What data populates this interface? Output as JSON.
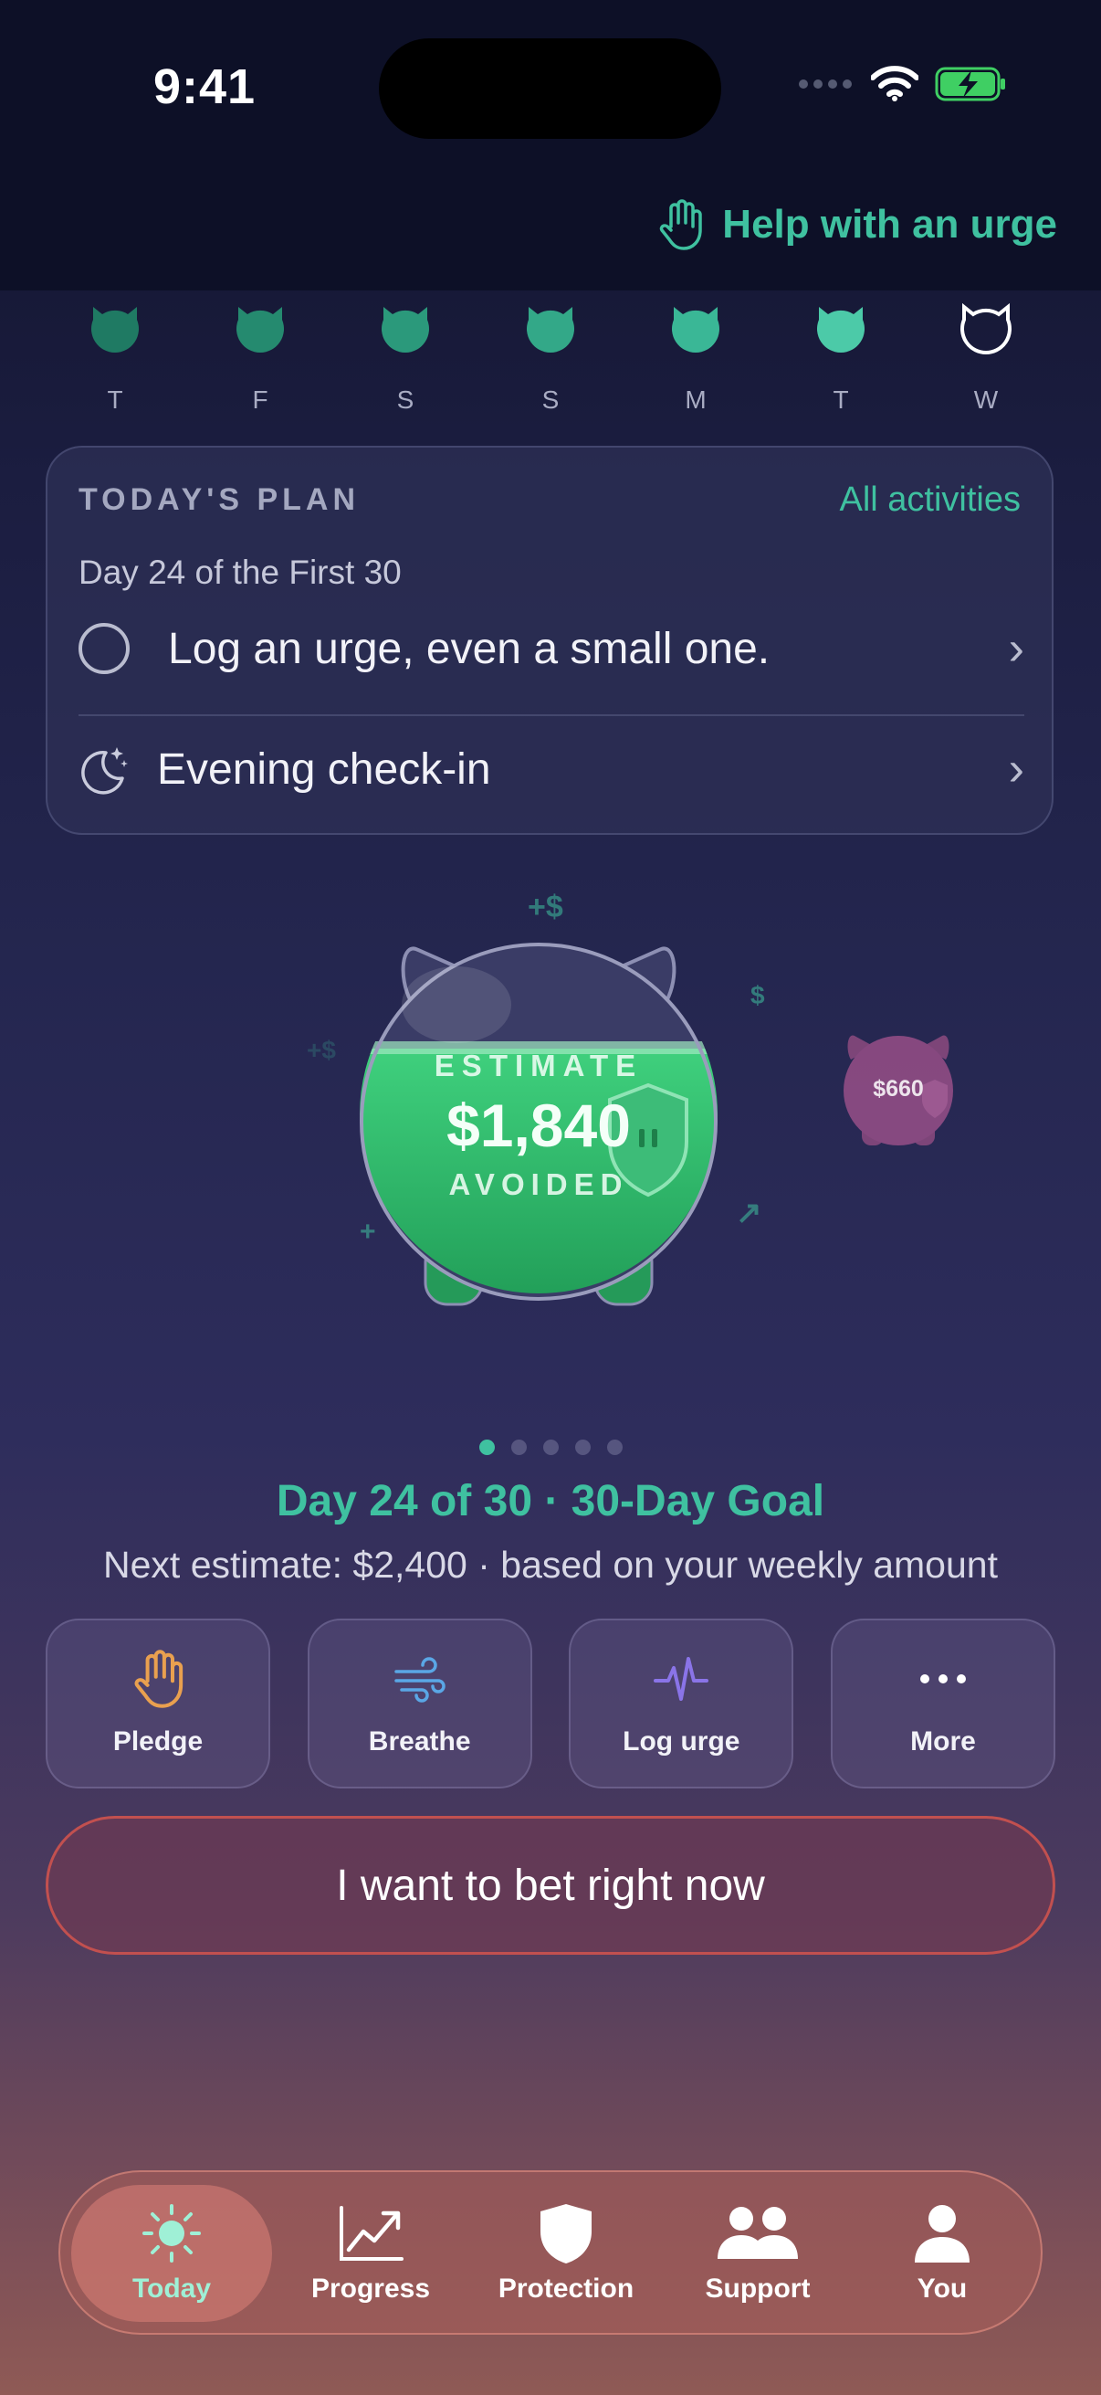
{
  "status_bar": {
    "time": "9:41"
  },
  "header": {
    "help_label": "Help with an urge"
  },
  "week": [
    {
      "label": "T",
      "color": "#1f7a63",
      "filled": true
    },
    {
      "label": "F",
      "color": "#258a6f",
      "filled": true
    },
    {
      "label": "S",
      "color": "#2b997b",
      "filled": true
    },
    {
      "label": "S",
      "color": "#33a888",
      "filled": true
    },
    {
      "label": "M",
      "color": "#3ab796",
      "filled": true
    },
    {
      "label": "T",
      "color": "#4ccaa8",
      "filled": true
    },
    {
      "label": "W",
      "color": "#ffffff",
      "filled": false
    }
  ],
  "plan": {
    "title": "TODAY'S PLAN",
    "all_link": "All activities",
    "subtitle": "Day 24 of the First 30",
    "items": [
      {
        "label": "Log an urge, even a small one.",
        "icon": "empty-circle-icon"
      },
      {
        "label": "Evening check-in",
        "icon": "moon-stars-icon"
      }
    ]
  },
  "savings": {
    "estimate_label": "ESTIMATE",
    "amount": "$1,840",
    "avoided_label": "AVOIDED",
    "secondary_goal_amount": "$660",
    "carousel_pages": 5,
    "active_page": 0
  },
  "goal_text": "Day 24 of 30 · 30-Day Goal",
  "next_estimate": "Next estimate: $2,400 · based on your weekly amount",
  "actions": [
    {
      "label": "Pledge",
      "icon": "hand-icon",
      "color": "#e9a04f"
    },
    {
      "label": "Breathe",
      "icon": "wind-icon",
      "color": "#5aa7e6"
    },
    {
      "label": "Log urge",
      "icon": "pulse-icon",
      "color": "#8a74e8"
    },
    {
      "label": "More",
      "icon": "more-icon",
      "color": "#ffffff"
    }
  ],
  "bet_button": "I want to bet right now",
  "tabs": [
    {
      "label": "Today",
      "icon": "sun-icon",
      "selected": true
    },
    {
      "label": "Progress",
      "icon": "chart-icon",
      "selected": false
    },
    {
      "label": "Protection",
      "icon": "shield-icon",
      "selected": false
    },
    {
      "label": "Support",
      "icon": "people-icon",
      "selected": false
    },
    {
      "label": "You",
      "icon": "person-icon",
      "selected": false
    }
  ],
  "colors": {
    "accent": "#3fc1a0",
    "danger": "#c2504f",
    "piggy_green": "#2fbf6a"
  }
}
